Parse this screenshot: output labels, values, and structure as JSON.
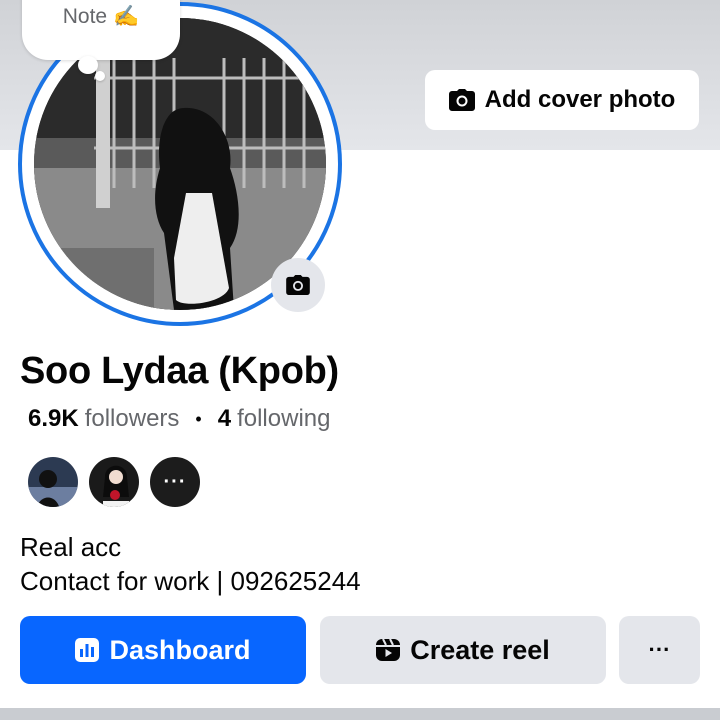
{
  "cover": {
    "add_cover_label": "Add cover photo",
    "icon": "camera-icon"
  },
  "note": {
    "label": "Note",
    "emoji": "✍️"
  },
  "profile": {
    "name": "Soo Lydaa (Kpob)",
    "followers_count": "6.9K",
    "followers_label": "followers",
    "separator": "•",
    "following_count": "4",
    "following_label": "following"
  },
  "friends": {
    "more_label": "···"
  },
  "bio": {
    "line1": "Real acc",
    "line2": "Contact for work | 092625244"
  },
  "actions": {
    "dashboard_label": "Dashboard",
    "create_reel_label": "Create reel",
    "more_label": "···"
  },
  "colors": {
    "accent": "#0866ff",
    "ring": "#1b74e4",
    "button_gray": "#e4e6eb",
    "secondary_text": "#65676b"
  }
}
